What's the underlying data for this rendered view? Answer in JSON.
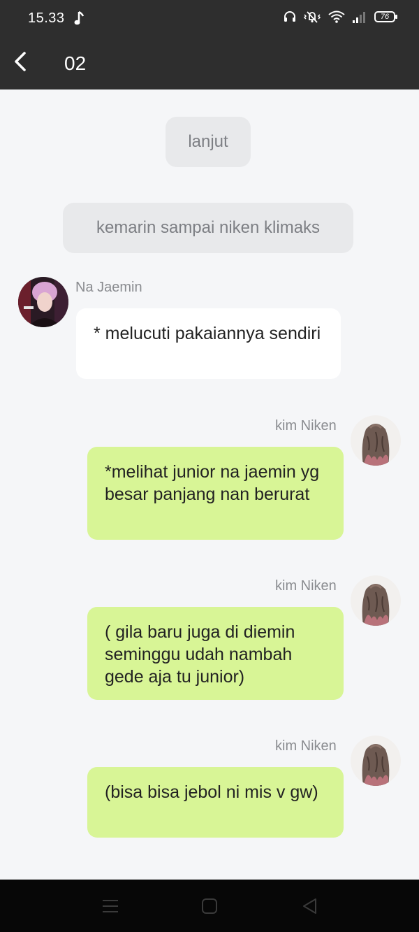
{
  "status_bar": {
    "time": "15.33",
    "battery": "76",
    "icons": [
      "music-note-icon",
      "headphones-icon",
      "mute-vibrate-icon",
      "wifi-icon",
      "signal-icon",
      "battery-icon"
    ]
  },
  "header": {
    "title": "02",
    "back_icon": "chevron-left-icon"
  },
  "system_messages": [
    "lanjut",
    "kemarin sampai niken klimaks"
  ],
  "messages": [
    {
      "sender": "Na Jaemin",
      "direction": "incoming",
      "text": "* melucuti pakaiannya sendiri"
    },
    {
      "sender": "kim Niken",
      "direction": "outgoing",
      "text": "*melihat junior na jaemin yg besar panjang nan berurat"
    },
    {
      "sender": "kim Niken",
      "direction": "outgoing",
      "text": "( gila baru juga di diemin seminggu udah nambah gede aja tu junior)"
    },
    {
      "sender": "kim Niken",
      "direction": "outgoing",
      "text": "(bisa bisa jebol ni mis v gw)"
    }
  ],
  "colors": {
    "header_bg": "#2e2e2e",
    "chat_bg": "#f5f6f8",
    "incoming_bubble": "#ffffff",
    "outgoing_bubble": "#d8f596",
    "system_pill": "#e8e9eb",
    "navbar_bg": "#070707"
  },
  "nav_bar": {
    "icons": [
      "menu-icon",
      "home-square-icon",
      "back-triangle-icon"
    ]
  }
}
